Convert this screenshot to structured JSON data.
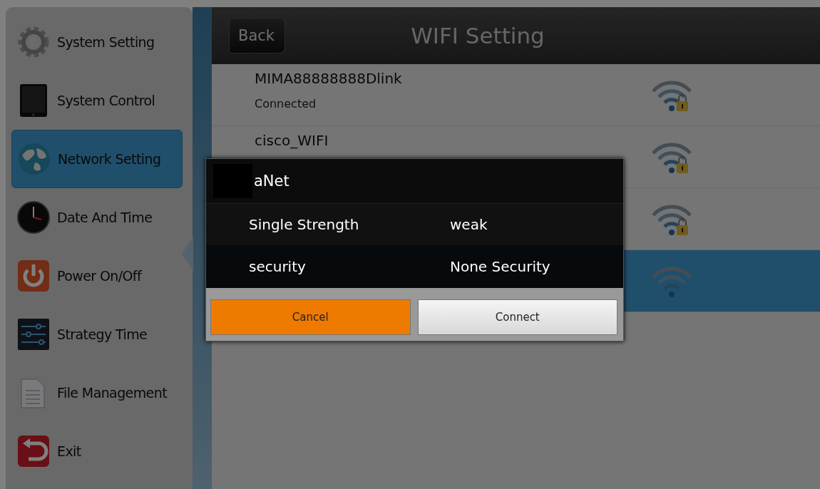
{
  "sidebar": {
    "items": [
      {
        "label": "System Setting",
        "kind": "gear",
        "selected": false
      },
      {
        "label": "System Control",
        "kind": "tablet",
        "selected": false
      },
      {
        "label": "Network Setting",
        "kind": "globe",
        "selected": true
      },
      {
        "label": "Date And Time",
        "kind": "clock",
        "selected": false
      },
      {
        "label": "Power On/Off",
        "kind": "power",
        "selected": false
      },
      {
        "label": "Strategy Time",
        "kind": "sliders",
        "selected": false
      },
      {
        "label": "File Management",
        "kind": "document",
        "selected": false
      },
      {
        "label": "Exit",
        "kind": "exit",
        "selected": false
      }
    ]
  },
  "header": {
    "back_button": "Back",
    "title": "WIFI Setting"
  },
  "networks": [
    {
      "name": "MIMA88888888Dlink",
      "status": "Connected",
      "secured": true,
      "selected": false
    },
    {
      "name": "cisco_WIFI",
      "secured": true,
      "selected": false
    },
    {
      "secured": true,
      "selected": false
    },
    {
      "secured": false,
      "selected": true
    }
  ],
  "dialog": {
    "title": "aNet",
    "rows": [
      {
        "label": "Single Strength",
        "value": "weak"
      },
      {
        "label": "security",
        "value": "None Security"
      }
    ],
    "buttons": [
      {
        "label": "Cancel",
        "kind": "cancel"
      },
      {
        "label": "Connect",
        "kind": "connect"
      }
    ]
  }
}
